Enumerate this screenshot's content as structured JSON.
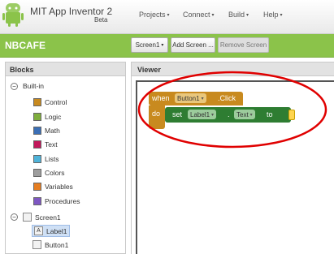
{
  "app": {
    "title": "MIT App Inventor 2",
    "subtitle": "Beta",
    "logo_icon": "android-robot-icon"
  },
  "menu": [
    {
      "label": "Projects"
    },
    {
      "label": "Connect"
    },
    {
      "label": "Build"
    },
    {
      "label": "Help"
    }
  ],
  "project": {
    "name": "NBCAFE",
    "screen_selector": "Screen1",
    "add_screen": "Add Screen ...",
    "remove_screen": "Remove Screen"
  },
  "blocks_panel": {
    "title": "Blocks",
    "builtin_label": "Built-in",
    "builtin": [
      {
        "label": "Control",
        "color": "#c88a1f"
      },
      {
        "label": "Logic",
        "color": "#7fae3d"
      },
      {
        "label": "Math",
        "color": "#3b6fb6"
      },
      {
        "label": "Text",
        "color": "#c2185b"
      },
      {
        "label": "Lists",
        "color": "#4fb3d9"
      },
      {
        "label": "Colors",
        "color": "#9e9e9e"
      },
      {
        "label": "Variables",
        "color": "#e67e22"
      },
      {
        "label": "Procedures",
        "color": "#7e57c2"
      }
    ],
    "screen_label": "Screen1",
    "components": [
      {
        "label": "Label1",
        "selected": true
      },
      {
        "label": "Button1",
        "selected": false
      }
    ]
  },
  "viewer": {
    "title": "Viewer",
    "event_block": {
      "when": "when",
      "component": "Button1",
      "event": ".Click",
      "do": "do"
    },
    "set_block": {
      "set": "set",
      "component": "Label1",
      "dot": ".",
      "property": "Text",
      "to": "to"
    },
    "highlight_color": "#e00000"
  }
}
